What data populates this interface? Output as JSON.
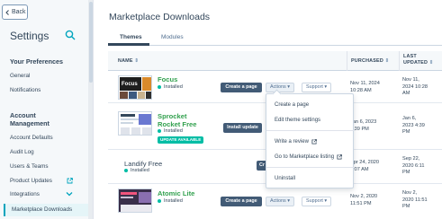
{
  "sidebar": {
    "back_label": "Back",
    "title": "Settings",
    "sections": [
      {
        "heading": "Your Preferences",
        "items": [
          "General",
          "Notifications"
        ]
      },
      {
        "heading": "Account Management",
        "items": [
          "Account Defaults",
          "Audit Log",
          "Users & Teams",
          "Product Updates",
          "Integrations",
          "Marketplace Downloads"
        ]
      }
    ],
    "account_heading_line1": "Account",
    "account_heading_line2": "Management",
    "active_item": "Marketplace Downloads"
  },
  "main": {
    "title": "Marketplace Downloads",
    "tabs": [
      "Themes",
      "Modules"
    ],
    "active_tab": "Themes",
    "columns": {
      "name": "NAME",
      "purchased": "PURCHASED",
      "updated_line1": "LAST",
      "updated_line2": "UPDATED"
    },
    "rows": [
      {
        "name": "Focus",
        "status": "Installed",
        "primary_action": "Create a page",
        "actions_label": "Actions",
        "support_label": "Support",
        "purchased_date": "Nov 11, 2024",
        "purchased_time": "10:28 AM",
        "updated_line1": "Nov 11,",
        "updated_line2": "2024 10:28",
        "updated_line3": "AM"
      },
      {
        "name_line1": "Sprocket",
        "name_line2": "Rocket Free",
        "status": "Installed",
        "badge": "UPDATE AVAILABLE",
        "primary_action": "Install update",
        "purchased_date": "Jan 6, 2023",
        "purchased_time": "2:39 PM",
        "updated_line1": "Jan 6,",
        "updated_line2": "2023 4:39",
        "updated_line3": "PM"
      },
      {
        "name": "Landify Free",
        "status": "Installed",
        "primary_action": "Cr",
        "purchased_date": "Apr 24, 2020",
        "purchased_time": "2:07 AM",
        "updated_line1": "Sep 22,",
        "updated_line2": "2020 6:11",
        "updated_line3": "PM"
      },
      {
        "name": "Atomic Lite",
        "status": "Installed",
        "primary_action": "Create a page",
        "actions_label": "Actions",
        "support_label": "Support",
        "purchased_date": "Nov 2, 2020",
        "purchased_time": "11:51 PM",
        "updated_line1": "Nov 2,",
        "updated_line2": "2020 11:51",
        "updated_line3": "PM"
      }
    ],
    "menu": {
      "items": [
        "Create a page",
        "Edit theme settings",
        "Write a review",
        "Go to Marketplace listing",
        "Uninstall"
      ]
    }
  },
  "colors": {
    "accent": "#00a4bd",
    "link_green": "#33a14f",
    "primary_button": "#425b76",
    "status_dot": "#00bda5"
  }
}
